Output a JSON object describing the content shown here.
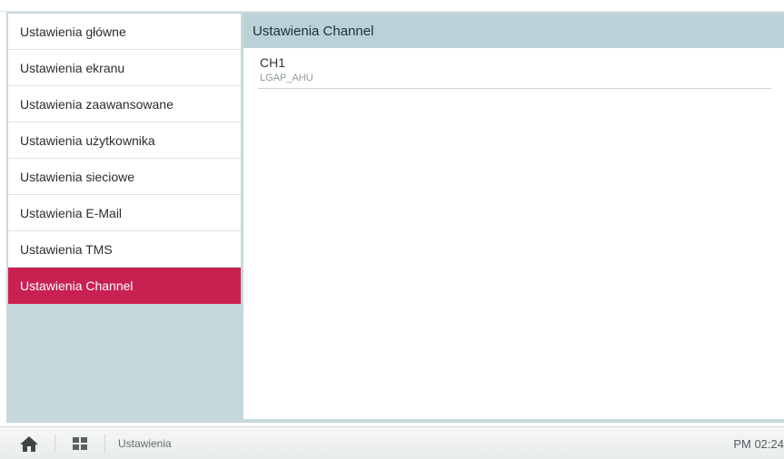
{
  "sidebar": {
    "items": [
      {
        "label": "Ustawienia główne"
      },
      {
        "label": "Ustawienia ekranu"
      },
      {
        "label": "Ustawienia zaawansowane"
      },
      {
        "label": "Ustawienia użytkownika"
      },
      {
        "label": "Ustawienia sieciowe"
      },
      {
        "label": "Ustawienia E-Mail"
      },
      {
        "label": "Ustawienia TMS"
      },
      {
        "label": "Ustawienia Channel"
      }
    ],
    "active_index": 7
  },
  "content": {
    "title": "Ustawienia Channel",
    "channels": [
      {
        "name": "CH1",
        "protocol": "LGAP_AHU"
      }
    ]
  },
  "bottom_bar": {
    "home_icon": "home-icon",
    "menu_icon": "grid-icon",
    "breadcrumb": "Ustawienia",
    "clock": "PM 02:24"
  },
  "colors": {
    "accent": "#c92052",
    "panel_bg": "#c7d8dc",
    "header_bg": "#b9d2d7"
  }
}
